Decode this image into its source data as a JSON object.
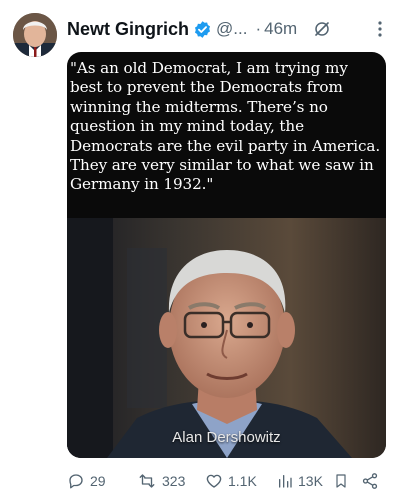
{
  "tweet": {
    "author_name": "Newt Gingrich",
    "handle": "@...",
    "separator": "·",
    "time": "46m"
  },
  "media": {
    "quote_text": "\"As an old Democrat, I am trying my best to prevent the Democrats from winning the midterms. There’s no question in my mind today, the Democrats are the evil party in America. They are very similar to what we saw in Germany in 1932.\"",
    "caption": "Alan Dershowitz"
  },
  "actions": {
    "replies": "29",
    "reposts": "323",
    "likes": "1.1K",
    "views": "13K"
  },
  "colors": {
    "verified": "#1d9bf0",
    "secondary_text": "#536471",
    "media_bg": "#0a0a0a"
  },
  "icons": {
    "verified": "verified-badge-icon",
    "grok": "grok-icon",
    "more": "more-icon",
    "reply": "reply-icon",
    "repost": "repost-icon",
    "like": "like-icon",
    "views": "views-icon",
    "bookmark": "bookmark-icon",
    "share": "share-icon"
  }
}
